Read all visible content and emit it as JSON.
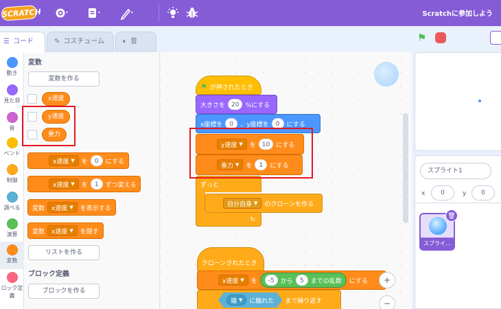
{
  "menubar": {
    "logo_text": "SCRATCH",
    "join_label": "Scratchに参加しよう"
  },
  "tabs": [
    {
      "label": "コード",
      "icon": "code-icon"
    },
    {
      "label": "コスチューム",
      "icon": "brush-icon"
    },
    {
      "label": "音",
      "icon": "speaker-icon"
    }
  ],
  "categories": [
    {
      "label": "動き",
      "color": "#4c97ff"
    },
    {
      "label": "見た目",
      "color": "#9966ff"
    },
    {
      "label": "音",
      "color": "#cf63cf"
    },
    {
      "label": "ベント",
      "color": "#ffbf00"
    },
    {
      "label": "制御",
      "color": "#ffab19"
    },
    {
      "label": "調べる",
      "color": "#5cb1d6"
    },
    {
      "label": "演算",
      "color": "#59c059"
    },
    {
      "label": "変数",
      "color": "#ff8c1a"
    },
    {
      "label": "ロック定義",
      "color": "#ff6680"
    }
  ],
  "palette": {
    "variables_heading": "変数",
    "make_variable": "変数を作る",
    "vars": [
      "x速度",
      "y速度",
      "重力"
    ],
    "set_block": {
      "var": "x速度",
      "value": "0",
      "suffix": "にする"
    },
    "change_block": {
      "var": "x速度",
      "value": "1",
      "suffix": "ずつ変える"
    },
    "show_block": {
      "prefix": "変数",
      "var": "x速度",
      "suffix": "を表示する"
    },
    "hide_block": {
      "prefix": "変数",
      "var": "x速度",
      "suffix": "を隠す"
    },
    "make_list": "リストを作る",
    "myblocks_heading": "ブロック定義",
    "make_block": "ブロックを作る",
    "wo": "を"
  },
  "script1": {
    "hat": "が押されたとき",
    "size_prefix": "大きさを",
    "size_value": "20",
    "size_suffix": "%にする",
    "goto_x_prefix": "x座標を",
    "goto_x": "0",
    "goto_y_prefix": "、y座標を",
    "goto_y": "0",
    "goto_suffix": "にする",
    "set1_var": "y速度",
    "set1_value": "10",
    "set2_var": "重力",
    "set2_value": "1",
    "wo": "を",
    "set_suffix": "にする",
    "forever": "ずっと",
    "clone_target": "自分自身",
    "clone_suffix": "のクローンを作る"
  },
  "script2": {
    "hat": "クローンされたとき",
    "set_var": "x速度",
    "wo": "を",
    "rand_from": "-5",
    "rand_kara": "から",
    "rand_to": "5",
    "rand_suffix": "までの乱数",
    "set_suffix": "にする",
    "touch_target": "端",
    "touch_suffix": "に触れた",
    "until_suffix": "まで繰り返す"
  },
  "sprite_info": {
    "name": "スプライト1",
    "x_label": "x",
    "x_value": "0",
    "y_label": "y",
    "y_value": "0"
  },
  "sprite_list": [
    {
      "label": "スプライ…"
    }
  ],
  "zoom": {
    "in": "+",
    "out": "−"
  }
}
